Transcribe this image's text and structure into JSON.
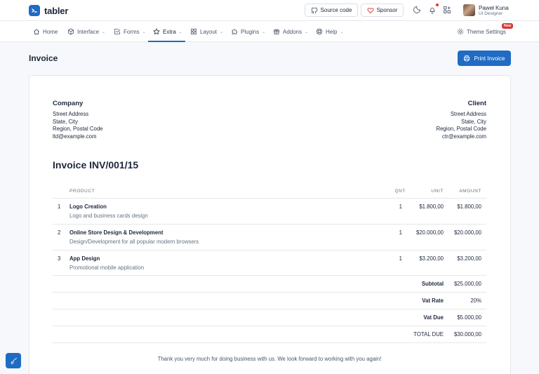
{
  "brand": {
    "name": "tabler"
  },
  "header": {
    "source_code_label": "Source code",
    "sponsor_label": "Sponsor",
    "user_name": "Paweł Kuna",
    "user_role": "UI Designer"
  },
  "nav": {
    "items": [
      {
        "label": "Home",
        "icon": "home-icon"
      },
      {
        "label": "Interface",
        "icon": "package-icon"
      },
      {
        "label": "Forms",
        "icon": "checkbox-icon"
      },
      {
        "label": "Extra",
        "icon": "star-icon"
      },
      {
        "label": "Layout",
        "icon": "layout-icon"
      },
      {
        "label": "Plugins",
        "icon": "puzzle-icon"
      },
      {
        "label": "Addons",
        "icon": "gift-icon"
      },
      {
        "label": "Help",
        "icon": "lifebuoy-icon"
      }
    ],
    "active": "Extra",
    "theme_settings_label": "Theme Settings",
    "new_badge": "New"
  },
  "page": {
    "title": "Invoice",
    "print_label": "Print Invoice"
  },
  "invoice": {
    "company": {
      "title": "Company",
      "lines": [
        "Street Address",
        "State, City",
        "Region, Postal Code",
        "ltd@example.com"
      ]
    },
    "client": {
      "title": "Client",
      "lines": [
        "Street Address",
        "State, City",
        "Region, Postal Code",
        "ctr@example.com"
      ]
    },
    "number": "Invoice INV/001/15",
    "columns": {
      "product": "Product",
      "qnt": "Qnt",
      "unit": "Unit",
      "amount": "Amount"
    },
    "items": [
      {
        "index": "1",
        "name": "Logo Creation",
        "desc": "Logo and business cards design",
        "qnt": "1",
        "unit": "$1.800,00",
        "amount": "$1.800,00"
      },
      {
        "index": "2",
        "name": "Online Store Design & Development",
        "desc": "Design/Development for all popular modern browsers",
        "qnt": "1",
        "unit": "$20.000,00",
        "amount": "$20.000,00"
      },
      {
        "index": "3",
        "name": "App Design",
        "desc": "Promotional mobile application",
        "qnt": "1",
        "unit": "$3.200,00",
        "amount": "$3.200,00"
      }
    ],
    "summary": {
      "subtotal_label": "Subtotal",
      "subtotal": "$25.000,00",
      "vat_rate_label": "Vat Rate",
      "vat_rate": "20%",
      "vat_due_label": "Vat Due",
      "vat_due": "$5.000,00",
      "total_label": "TOTAL DUE",
      "total": "$30.000,00"
    },
    "thanks": "Thank you very much for doing business with us. We look forward to working with you again!"
  },
  "colors": {
    "primary": "#206bc4",
    "danger": "#d63939",
    "text": "#1d273b",
    "muted": "#667382"
  }
}
